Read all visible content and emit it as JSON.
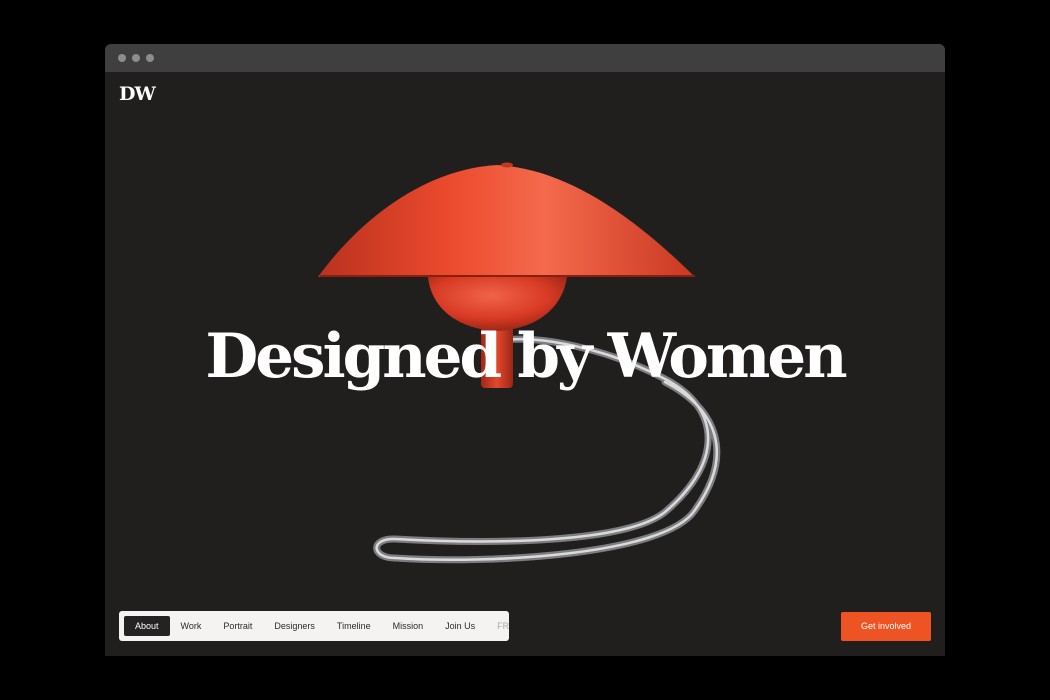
{
  "logo": {
    "text": "DW"
  },
  "hero": {
    "title": "Designed by Women",
    "image_icon": "table-lamp-icon"
  },
  "nav": {
    "items": [
      {
        "label": "About",
        "active": true
      },
      {
        "label": "Work"
      },
      {
        "label": "Portrait"
      },
      {
        "label": "Designers"
      },
      {
        "label": "Timeline"
      },
      {
        "label": "Mission"
      },
      {
        "label": "Join Us"
      },
      {
        "label": "FR",
        "muted": true
      }
    ]
  },
  "cta": {
    "label": "Get involved"
  },
  "colors": {
    "page_bg": "#211f1e",
    "accent": "#ee5323",
    "lamp_red": "#e8442b",
    "nav_bg": "#f4f3f1"
  }
}
